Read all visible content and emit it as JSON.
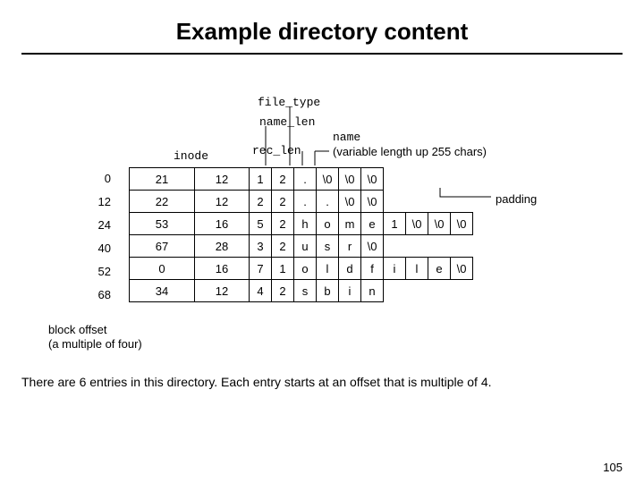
{
  "title": "Example directory  content",
  "labels": {
    "file_type": "file_type",
    "name_len": "name_len",
    "rec_len": "rec_len",
    "inode": "inode",
    "name1": "name",
    "name2": "(variable length up 255 chars)",
    "padding": "padding",
    "block1": "block offset",
    "block2": "(a multiple of four)"
  },
  "offsets": [
    "0",
    "12",
    "24",
    "40",
    "52",
    "68"
  ],
  "rows": [
    {
      "inode": "21",
      "rec": "12",
      "nl": "1",
      "ft": "2",
      "ch": [
        ".",
        "\\0",
        "\\0",
        "\\0"
      ]
    },
    {
      "inode": "22",
      "rec": "12",
      "nl": "2",
      "ft": "2",
      "ch": [
        ".",
        ".",
        "\\0",
        "\\0"
      ]
    },
    {
      "inode": "53",
      "rec": "16",
      "nl": "5",
      "ft": "2",
      "ch": [
        "h",
        "o",
        "m",
        "e",
        "1",
        "\\0",
        "\\0",
        "\\0"
      ]
    },
    {
      "inode": "67",
      "rec": "28",
      "nl": "3",
      "ft": "2",
      "ch": [
        "u",
        "s",
        "r",
        "\\0"
      ]
    },
    {
      "inode": "0",
      "rec": "16",
      "nl": "7",
      "ft": "1",
      "ch": [
        "o",
        "l",
        "d",
        "f",
        "i",
        "l",
        "e",
        "\\0"
      ]
    },
    {
      "inode": "34",
      "rec": "12",
      "nl": "4",
      "ft": "2",
      "ch": [
        "s",
        "b",
        "i",
        "n"
      ]
    }
  ],
  "summary": "There are 6 entries in this directory. Each entry starts at an offset that is multiple of 4.",
  "page": "105"
}
